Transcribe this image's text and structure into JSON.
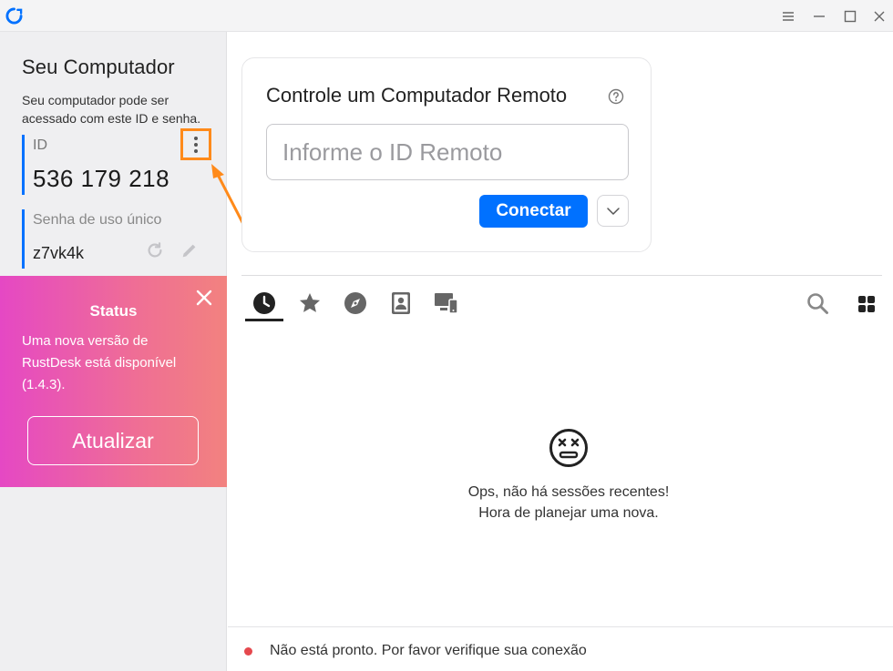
{
  "window": {
    "app": "RustDesk",
    "brand_color": "#0071ff"
  },
  "left": {
    "title": "Seu Computador",
    "description": "Seu computador pode ser acessado com este ID e senha.",
    "id_label": "ID",
    "id_value": "536 179 218",
    "password_label": "Senha de uso único",
    "password_value": "z7vk4k",
    "highlight_color": "#ff8a1a"
  },
  "status_card": {
    "title": "Status",
    "message": "Uma nova versão de RustDesk está disponível (1.4.3).",
    "update_label": "Atualizar"
  },
  "remote": {
    "title": "Controle um Computador Remoto",
    "input_placeholder": "Informe o ID Remoto",
    "connect_label": "Conectar"
  },
  "tabs": [
    {
      "icon": "clock-icon",
      "active": true
    },
    {
      "icon": "star-icon",
      "active": false
    },
    {
      "icon": "compass-icon",
      "active": false
    },
    {
      "icon": "address-book-icon",
      "active": false
    },
    {
      "icon": "devices-icon",
      "active": false
    }
  ],
  "empty": {
    "line1": "Ops, não há sessões recentes!",
    "line2": "Hora de planejar uma nova."
  },
  "statusbar": {
    "text": "Não está pronto. Por favor verifique sua conexão",
    "dot_color": "#e5484d"
  }
}
